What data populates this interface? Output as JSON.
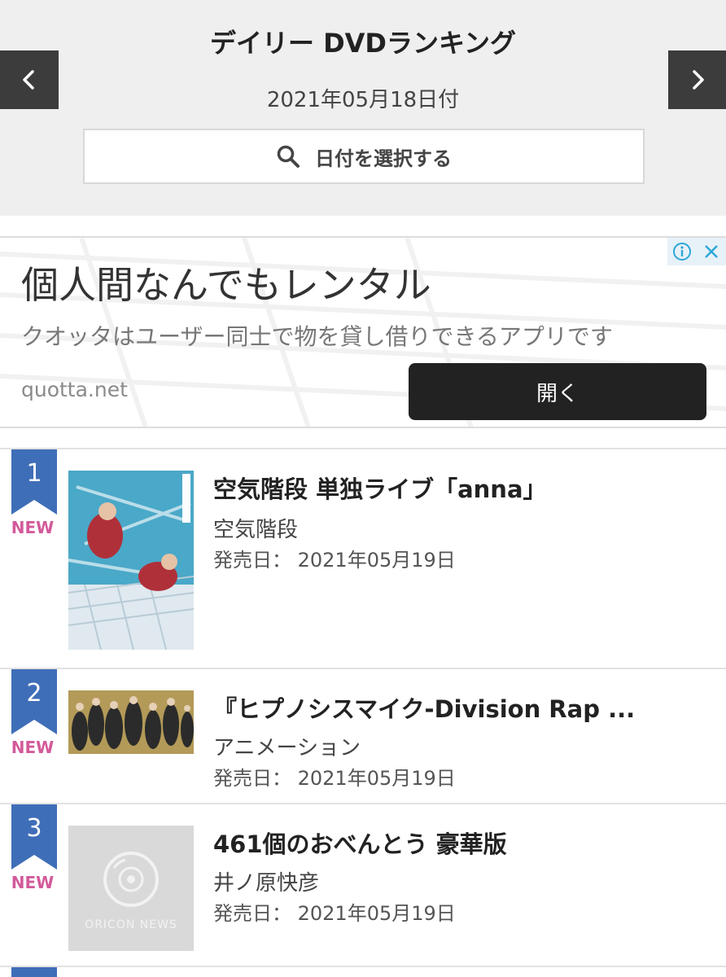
{
  "header": {
    "title": "デイリー DVDランキング",
    "date": "2021年05月18日付",
    "date_select_label": "日付を選択する"
  },
  "ad": {
    "headline": "個人間なんでもレンタル",
    "description": "クオッタはユーザー同士で物を貸し借りできるアプリです",
    "domain": "quotta.net",
    "open_label": "開く"
  },
  "ranking": {
    "items": [
      {
        "rank": "1",
        "badge": "NEW",
        "title": "空気階段 単独ライブ「anna」",
        "artist": "空気階段",
        "release": "発売日： 2021年05月19日",
        "thumb_logo": ""
      },
      {
        "rank": "2",
        "badge": "NEW",
        "title": "『ヒプノシスマイク-Division Rap ...",
        "artist": "アニメーション",
        "release": "発売日： 2021年05月19日",
        "thumb_logo": ""
      },
      {
        "rank": "3",
        "badge": "NEW",
        "title": "461個のおべんとう 豪華版",
        "artist": "井ノ原快彦",
        "release": "発売日： 2021年05月19日",
        "thumb_logo": "ORICON NEWS"
      }
    ]
  },
  "colors": {
    "header_bg": "#efefef",
    "nav_bg": "#3c3c3c",
    "rank_badge": "#3f6eb8",
    "new_label": "#d35a9a",
    "ad_button": "#222222"
  },
  "icons": {
    "prev": "chevron-left-icon",
    "next": "chevron-right-icon",
    "search": "search-icon",
    "ad_info": "info-icon",
    "ad_close": "close-icon",
    "placeholder": "disc-icon"
  }
}
